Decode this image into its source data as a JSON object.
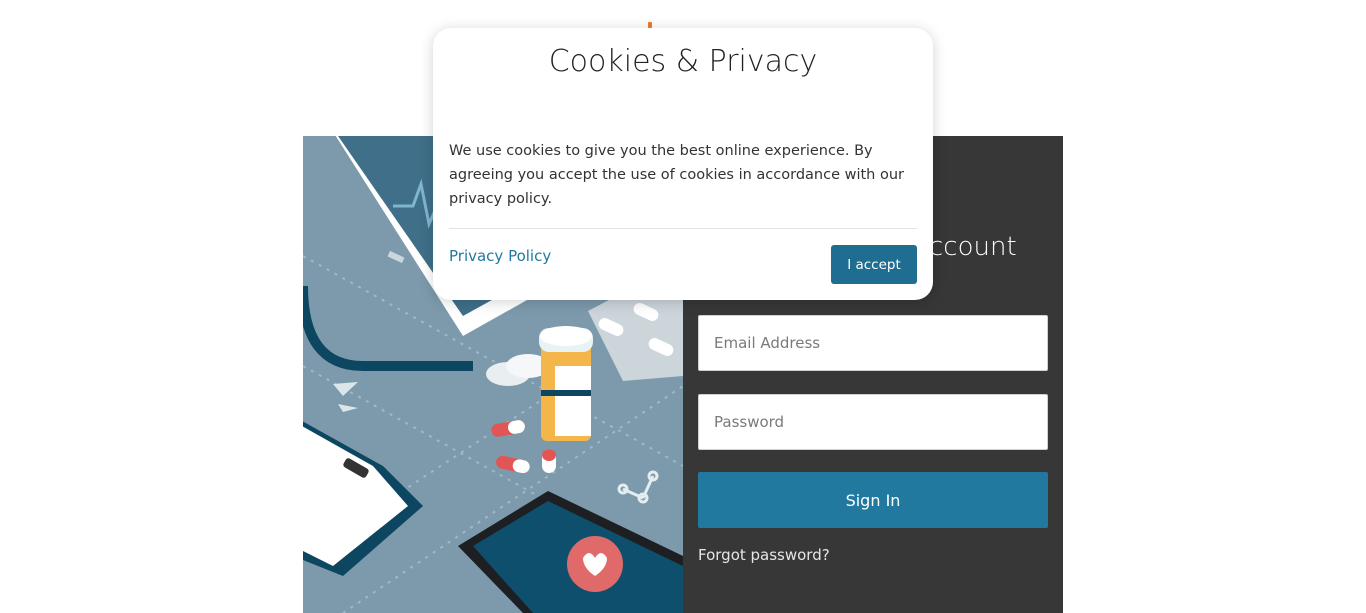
{
  "cookie_banner": {
    "title": "Cookies & Privacy",
    "body": "We use cookies to give you the best online experience. By agreeing you accept the use of cookies in accordance with our privacy policy.",
    "privacy_link": "Privacy Policy",
    "accept_label": "I accept"
  },
  "login": {
    "title_visible": "ccount",
    "email_placeholder": "Email Address",
    "password_placeholder": "Password",
    "signin_label": "Sign In",
    "forgot_label": "Forgot password?"
  },
  "colors": {
    "accent": "#2179a0",
    "panel_bg": "#373737",
    "illustration_bg": "#7c9aab",
    "logo_orange": "#f07a2b"
  }
}
